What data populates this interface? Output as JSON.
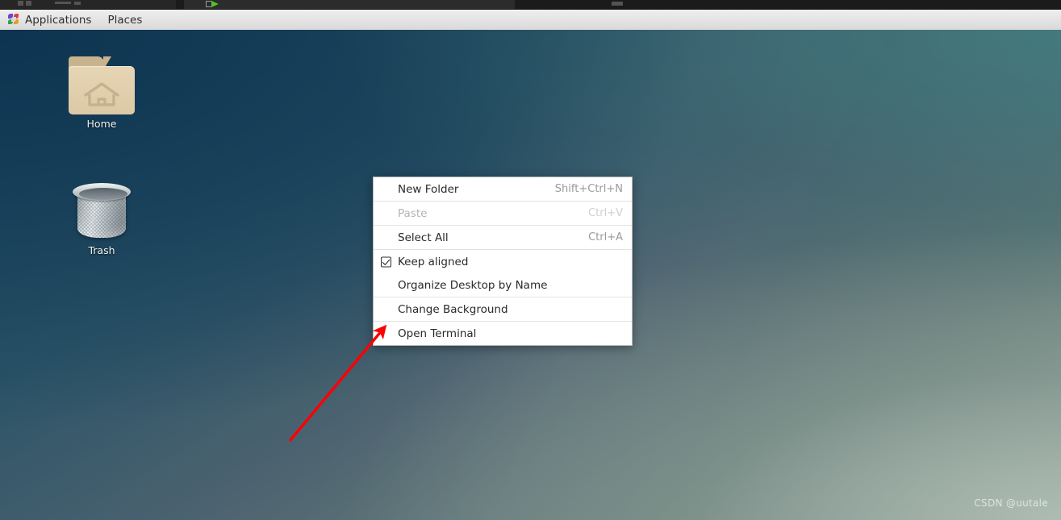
{
  "panel": {
    "applications_label": "Applications",
    "places_label": "Places",
    "logo_name": "fedora-logo-icon"
  },
  "desktop": {
    "icons": [
      {
        "label": "Home",
        "icon": "home-folder-icon"
      },
      {
        "label": "Trash",
        "icon": "trash-bin-icon"
      }
    ]
  },
  "context_menu": {
    "items": [
      {
        "label": "New Folder",
        "accel": "Shift+Ctrl+N",
        "disabled": false,
        "checkbox": false,
        "separator_after": true
      },
      {
        "label": "Paste",
        "accel": "Ctrl+V",
        "disabled": true,
        "checkbox": false,
        "separator_after": true
      },
      {
        "label": "Select All",
        "accel": "Ctrl+A",
        "disabled": false,
        "checkbox": false,
        "separator_after": true
      },
      {
        "label": "Keep aligned",
        "accel": "",
        "disabled": false,
        "checkbox": true,
        "checked": true,
        "separator_after": false
      },
      {
        "label": "Organize Desktop by Name",
        "accel": "",
        "disabled": false,
        "checkbox": false,
        "separator_after": true
      },
      {
        "label": "Change Background",
        "accel": "",
        "disabled": false,
        "checkbox": false,
        "separator_after": true
      },
      {
        "label": "Open Terminal",
        "accel": "",
        "disabled": false,
        "checkbox": false,
        "separator_after": false
      }
    ]
  },
  "annotation": {
    "arrow_color": "#ff0000",
    "points_to": "Open Terminal"
  },
  "watermark": {
    "text": "CSDN @uutale"
  },
  "colors": {
    "panel_background": "#e4e4e4",
    "menu_background": "#ffffff",
    "menu_border": "#b9b9b9",
    "accel_text": "#9a9a9a",
    "disabled_text": "#b4b4b4",
    "wallpaper_top_left": "#123a55",
    "wallpaper_top_right": "#3d6b70",
    "wallpaper_bottom_right": "#8d9b94",
    "folder_body": "#e1cfae",
    "arrow_red": "#ff0000"
  }
}
